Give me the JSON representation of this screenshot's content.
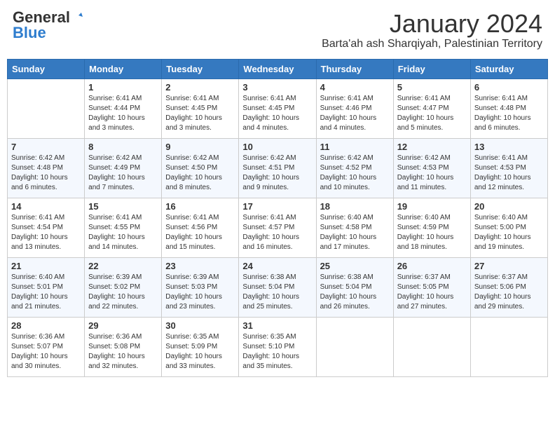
{
  "header": {
    "logo_general": "General",
    "logo_blue": "Blue",
    "month_title": "January 2024",
    "location": "Barta'ah ash Sharqiyah, Palestinian Territory"
  },
  "days_of_week": [
    "Sunday",
    "Monday",
    "Tuesday",
    "Wednesday",
    "Thursday",
    "Friday",
    "Saturday"
  ],
  "weeks": [
    [
      {
        "day": "",
        "info": ""
      },
      {
        "day": "1",
        "info": "Sunrise: 6:41 AM\nSunset: 4:44 PM\nDaylight: 10 hours\nand 3 minutes."
      },
      {
        "day": "2",
        "info": "Sunrise: 6:41 AM\nSunset: 4:45 PM\nDaylight: 10 hours\nand 3 minutes."
      },
      {
        "day": "3",
        "info": "Sunrise: 6:41 AM\nSunset: 4:45 PM\nDaylight: 10 hours\nand 4 minutes."
      },
      {
        "day": "4",
        "info": "Sunrise: 6:41 AM\nSunset: 4:46 PM\nDaylight: 10 hours\nand 4 minutes."
      },
      {
        "day": "5",
        "info": "Sunrise: 6:41 AM\nSunset: 4:47 PM\nDaylight: 10 hours\nand 5 minutes."
      },
      {
        "day": "6",
        "info": "Sunrise: 6:41 AM\nSunset: 4:48 PM\nDaylight: 10 hours\nand 6 minutes."
      }
    ],
    [
      {
        "day": "7",
        "info": "Sunrise: 6:42 AM\nSunset: 4:48 PM\nDaylight: 10 hours\nand 6 minutes."
      },
      {
        "day": "8",
        "info": "Sunrise: 6:42 AM\nSunset: 4:49 PM\nDaylight: 10 hours\nand 7 minutes."
      },
      {
        "day": "9",
        "info": "Sunrise: 6:42 AM\nSunset: 4:50 PM\nDaylight: 10 hours\nand 8 minutes."
      },
      {
        "day": "10",
        "info": "Sunrise: 6:42 AM\nSunset: 4:51 PM\nDaylight: 10 hours\nand 9 minutes."
      },
      {
        "day": "11",
        "info": "Sunrise: 6:42 AM\nSunset: 4:52 PM\nDaylight: 10 hours\nand 10 minutes."
      },
      {
        "day": "12",
        "info": "Sunrise: 6:42 AM\nSunset: 4:53 PM\nDaylight: 10 hours\nand 11 minutes."
      },
      {
        "day": "13",
        "info": "Sunrise: 6:41 AM\nSunset: 4:53 PM\nDaylight: 10 hours\nand 12 minutes."
      }
    ],
    [
      {
        "day": "14",
        "info": "Sunrise: 6:41 AM\nSunset: 4:54 PM\nDaylight: 10 hours\nand 13 minutes."
      },
      {
        "day": "15",
        "info": "Sunrise: 6:41 AM\nSunset: 4:55 PM\nDaylight: 10 hours\nand 14 minutes."
      },
      {
        "day": "16",
        "info": "Sunrise: 6:41 AM\nSunset: 4:56 PM\nDaylight: 10 hours\nand 15 minutes."
      },
      {
        "day": "17",
        "info": "Sunrise: 6:41 AM\nSunset: 4:57 PM\nDaylight: 10 hours\nand 16 minutes."
      },
      {
        "day": "18",
        "info": "Sunrise: 6:40 AM\nSunset: 4:58 PM\nDaylight: 10 hours\nand 17 minutes."
      },
      {
        "day": "19",
        "info": "Sunrise: 6:40 AM\nSunset: 4:59 PM\nDaylight: 10 hours\nand 18 minutes."
      },
      {
        "day": "20",
        "info": "Sunrise: 6:40 AM\nSunset: 5:00 PM\nDaylight: 10 hours\nand 19 minutes."
      }
    ],
    [
      {
        "day": "21",
        "info": "Sunrise: 6:40 AM\nSunset: 5:01 PM\nDaylight: 10 hours\nand 21 minutes."
      },
      {
        "day": "22",
        "info": "Sunrise: 6:39 AM\nSunset: 5:02 PM\nDaylight: 10 hours\nand 22 minutes."
      },
      {
        "day": "23",
        "info": "Sunrise: 6:39 AM\nSunset: 5:03 PM\nDaylight: 10 hours\nand 23 minutes."
      },
      {
        "day": "24",
        "info": "Sunrise: 6:38 AM\nSunset: 5:04 PM\nDaylight: 10 hours\nand 25 minutes."
      },
      {
        "day": "25",
        "info": "Sunrise: 6:38 AM\nSunset: 5:04 PM\nDaylight: 10 hours\nand 26 minutes."
      },
      {
        "day": "26",
        "info": "Sunrise: 6:37 AM\nSunset: 5:05 PM\nDaylight: 10 hours\nand 27 minutes."
      },
      {
        "day": "27",
        "info": "Sunrise: 6:37 AM\nSunset: 5:06 PM\nDaylight: 10 hours\nand 29 minutes."
      }
    ],
    [
      {
        "day": "28",
        "info": "Sunrise: 6:36 AM\nSunset: 5:07 PM\nDaylight: 10 hours\nand 30 minutes."
      },
      {
        "day": "29",
        "info": "Sunrise: 6:36 AM\nSunset: 5:08 PM\nDaylight: 10 hours\nand 32 minutes."
      },
      {
        "day": "30",
        "info": "Sunrise: 6:35 AM\nSunset: 5:09 PM\nDaylight: 10 hours\nand 33 minutes."
      },
      {
        "day": "31",
        "info": "Sunrise: 6:35 AM\nSunset: 5:10 PM\nDaylight: 10 hours\nand 35 minutes."
      },
      {
        "day": "",
        "info": ""
      },
      {
        "day": "",
        "info": ""
      },
      {
        "day": "",
        "info": ""
      }
    ]
  ]
}
